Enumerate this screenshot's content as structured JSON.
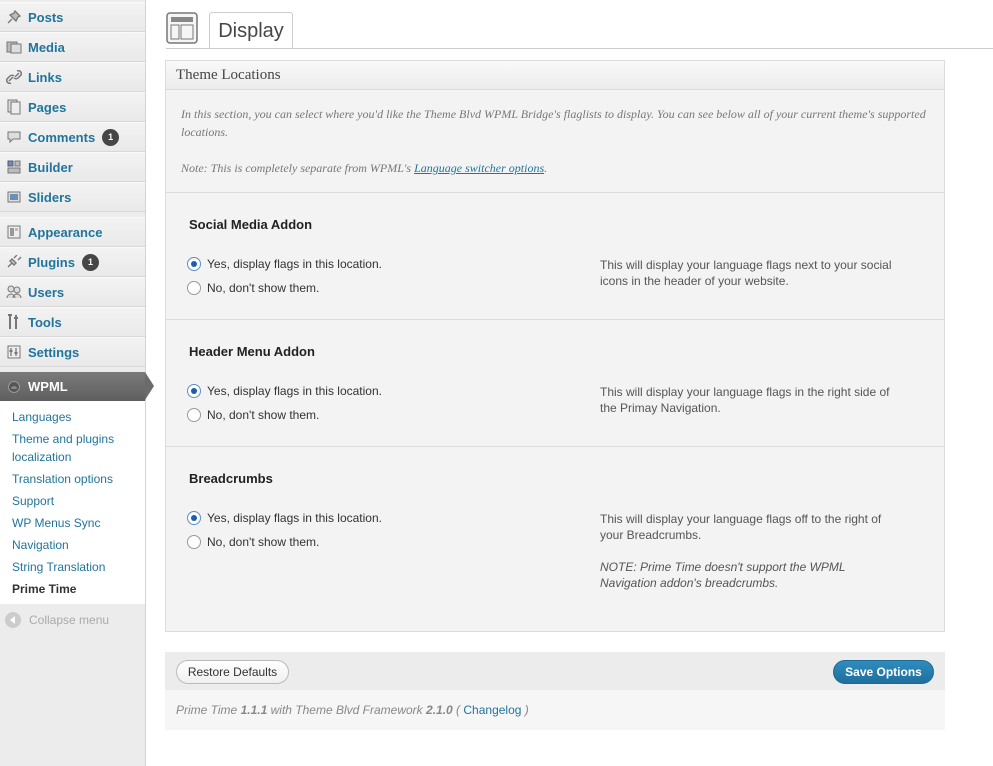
{
  "sidebar": {
    "items": [
      {
        "label": "Posts",
        "icon": "pin-icon"
      },
      {
        "label": "Media",
        "icon": "media-icon"
      },
      {
        "label": "Links",
        "icon": "link-icon"
      },
      {
        "label": "Pages",
        "icon": "pages-icon"
      },
      {
        "label": "Comments",
        "icon": "comment-icon",
        "badge": "1"
      },
      {
        "label": "Builder",
        "icon": "builder-icon"
      },
      {
        "label": "Sliders",
        "icon": "sliders-icon"
      },
      {
        "label": "Appearance",
        "icon": "appearance-icon"
      },
      {
        "label": "Plugins",
        "icon": "plugin-icon",
        "badge": "1"
      },
      {
        "label": "Users",
        "icon": "users-icon"
      },
      {
        "label": "Tools",
        "icon": "tools-icon"
      },
      {
        "label": "Settings",
        "icon": "settings-icon"
      }
    ],
    "active": {
      "label": "WPML",
      "icon": "wpml-icon"
    },
    "submenu": [
      "Languages",
      "Theme and plugins localization",
      "Translation options",
      "Support",
      "WP Menus Sync",
      "Navigation",
      "String Translation",
      "Prime Time"
    ],
    "collapse_label": "Collapse menu"
  },
  "header": {
    "tab": "Display"
  },
  "panel": {
    "title": "Theme Locations",
    "intro_text": "In this section, you can select where you'd like the Theme Blvd WPML Bridge's flaglists to display. You can see below all of your current theme's supported locations.",
    "note_prefix": "Note: This is completely separate from WPML's ",
    "note_link": "Language switcher options",
    "note_suffix": ".",
    "sections": [
      {
        "title": "Social Media Addon",
        "yes": "Yes, display flags in this location.",
        "no": "No, don't show them.",
        "selected": "yes",
        "desc": "This will display your language flags next to your social icons in the header of your website.",
        "note": ""
      },
      {
        "title": "Header Menu Addon",
        "yes": "Yes, display flags in this location.",
        "no": "No, don't show them.",
        "selected": "yes",
        "desc": "This will display your language flags in the right side of the Primay Navigation.",
        "note": ""
      },
      {
        "title": "Breadcrumbs",
        "yes": "Yes, display flags in this location.",
        "no": "No, don't show them.",
        "selected": "yes",
        "desc": "This will display your language flags off to the right of your Breadcrumbs.",
        "note": "NOTE: Prime Time doesn't support the WPML Navigation addon's breadcrumbs."
      }
    ]
  },
  "footer": {
    "restore_label": "Restore Defaults",
    "save_label": "Save Options",
    "version_theme": "Prime Time",
    "version_theme_num": "1.1.1",
    "version_mid": "with Theme Blvd Framework",
    "version_fw_num": "2.1.0",
    "changelog_label": "Changelog"
  },
  "colors": {
    "link": "#21759b",
    "save_button": "#2184b7",
    "badge": "#464646"
  }
}
